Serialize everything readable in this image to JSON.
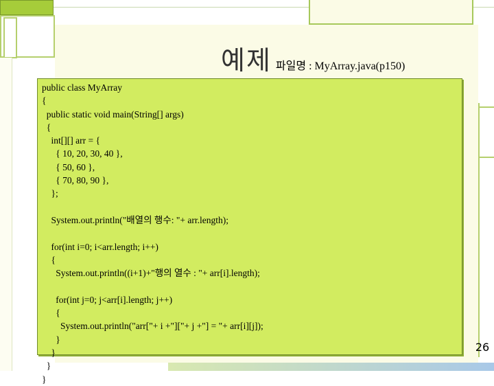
{
  "slide": {
    "title": "예제",
    "subtitle": "파일명 : MyArray.java(p150)",
    "page_number": "26"
  },
  "code": {
    "lines": [
      "public class MyArray",
      "{",
      "  public static void main(String[] args)",
      "  {",
      "    int[][] arr = {",
      "      { 10, 20, 30, 40 },",
      "      { 50, 60 },",
      "      { 70, 80, 90 },",
      "    };",
      "",
      "    System.out.println(\"배열의 행수: \"+ arr.length);",
      "",
      "    for(int i=0; i<arr.length; i++)",
      "    {",
      "      System.out.println((i+1)+\"행의 열수 : \"+ arr[i].length);",
      "",
      "      for(int j=0; j<arr[i].length; j++)",
      "      {",
      "        System.out.println(\"arr[\"+ i +\"][\"+ j +\"] = \"+ arr[i][j]);",
      "      }",
      "    }",
      "  }",
      "}"
    ]
  },
  "colors": {
    "code_background": "#d2ec60",
    "slide_background": "#fbfbe6",
    "accent_green": "#a6cc3a"
  }
}
